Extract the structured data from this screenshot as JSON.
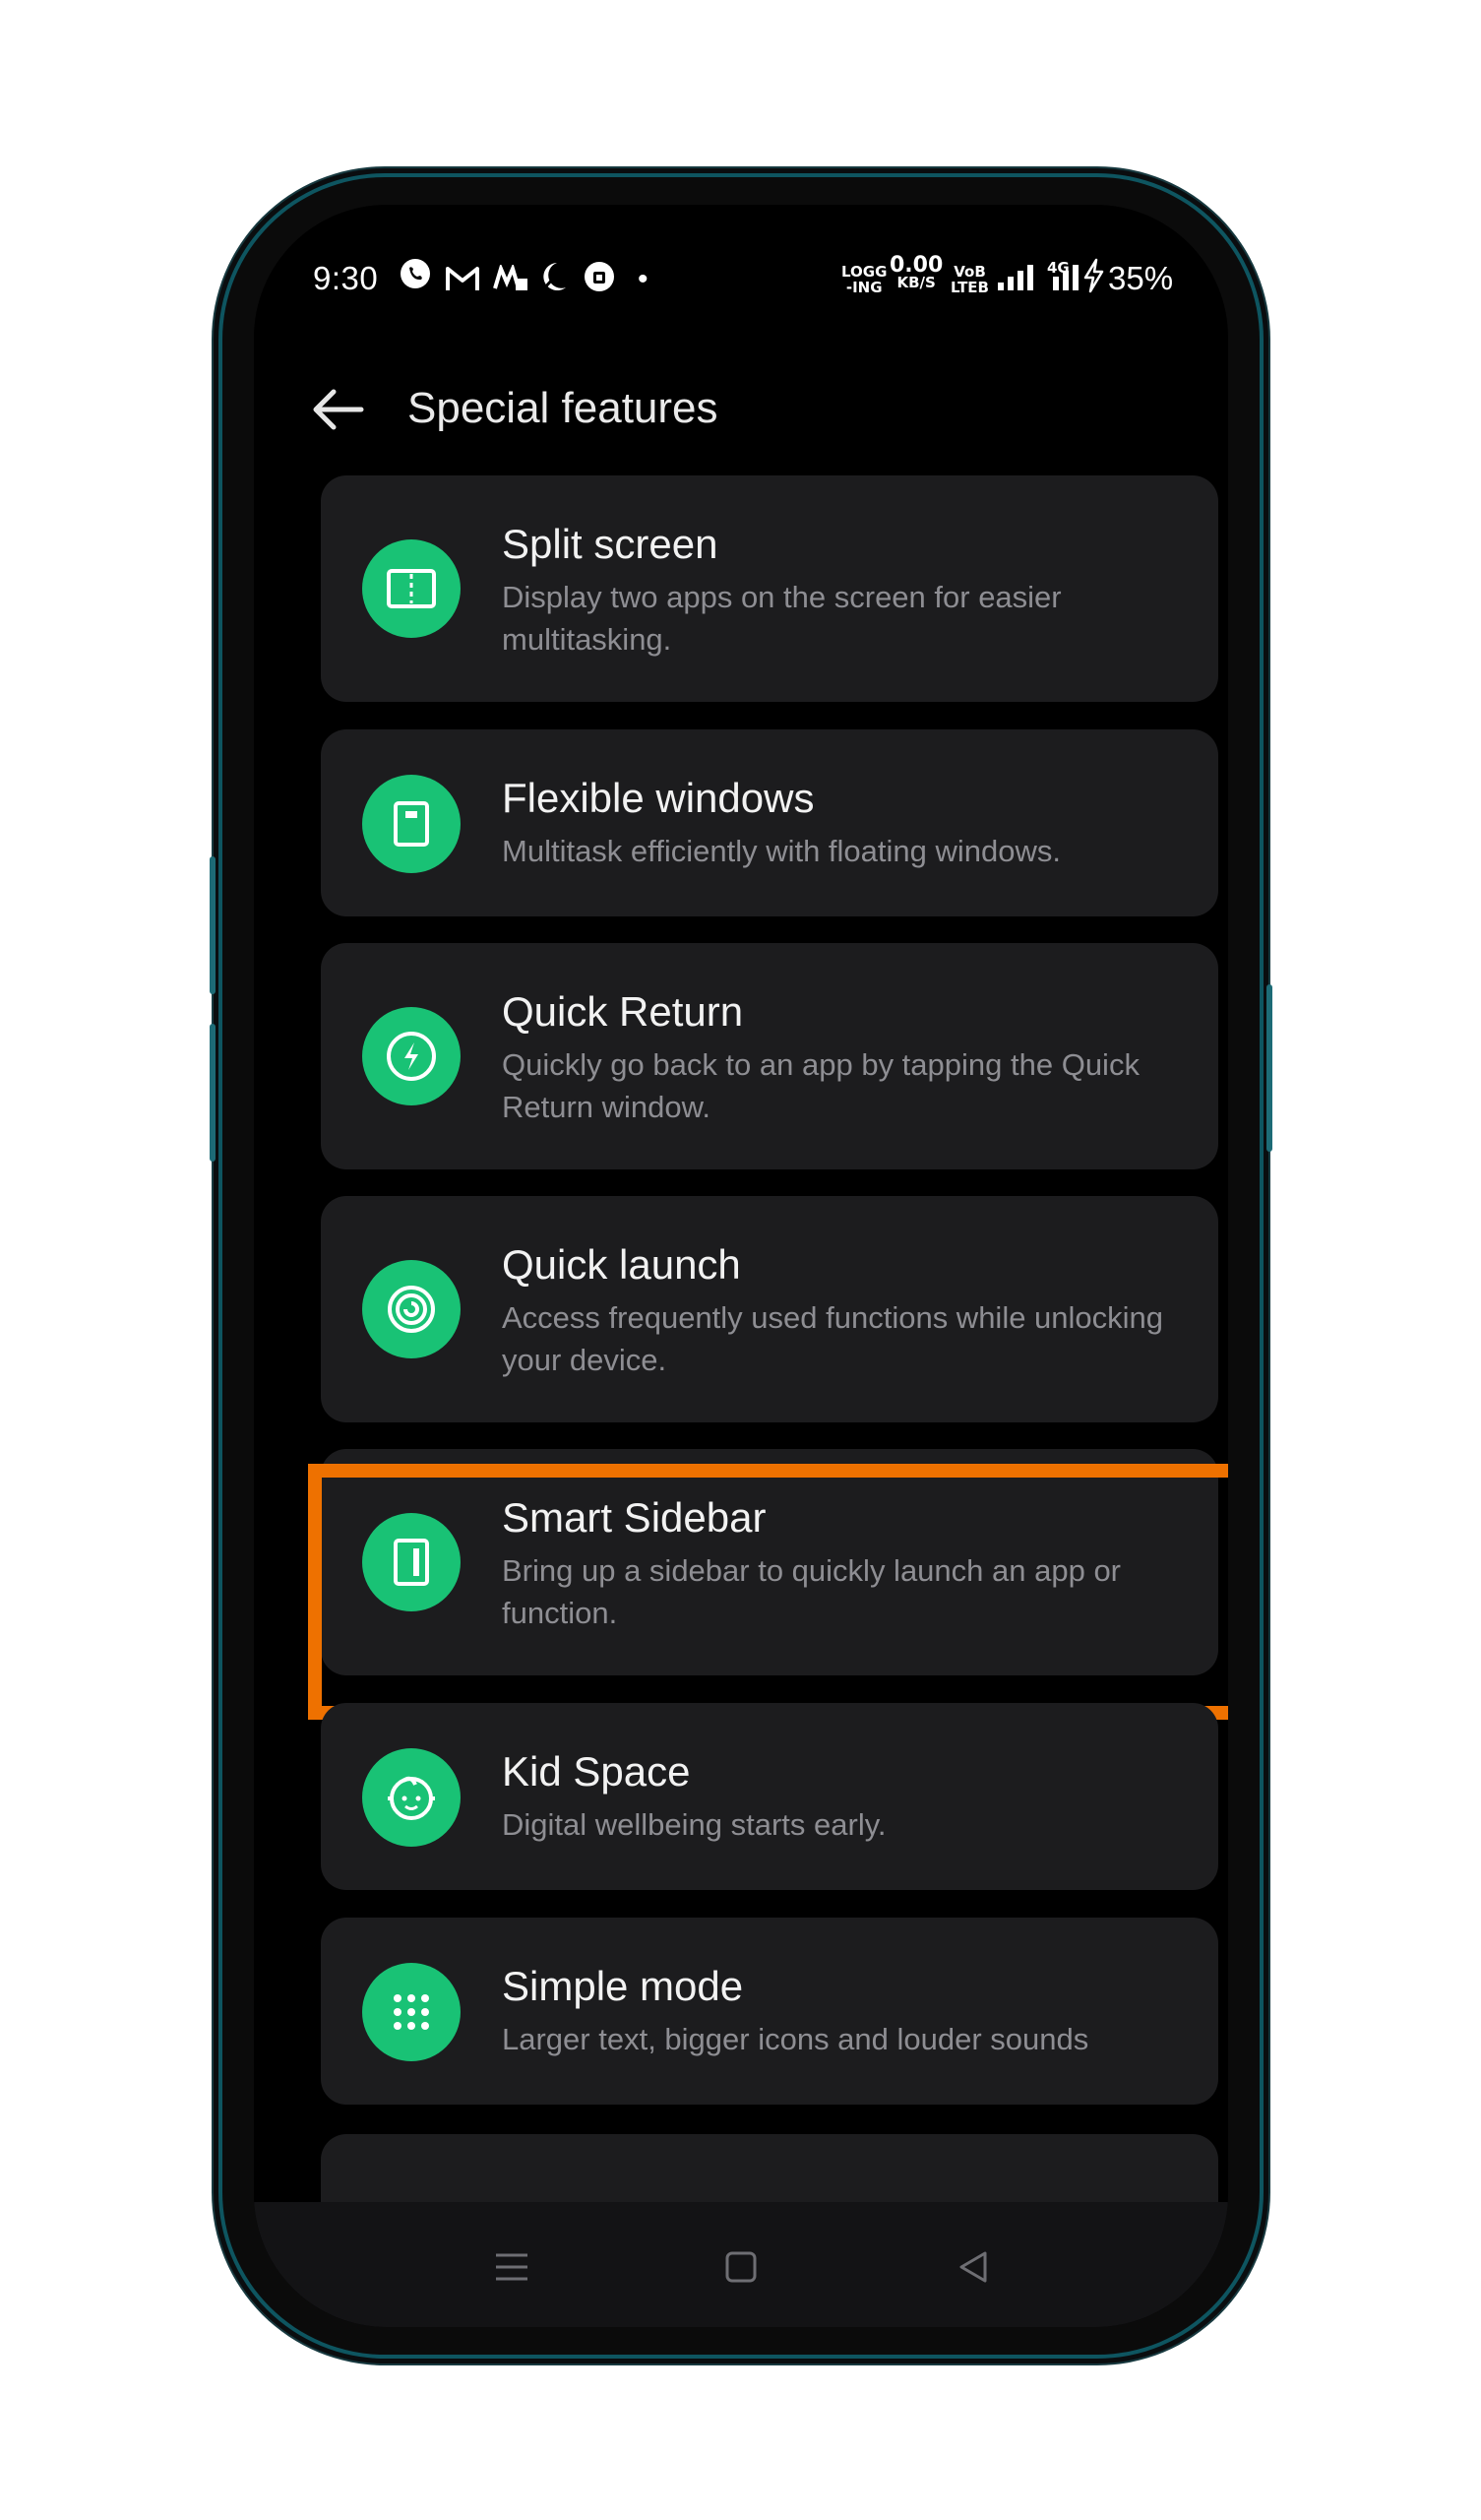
{
  "status_bar": {
    "time": "9:30",
    "net_label_top": "LOGG",
    "net_label_bottom": "-ING",
    "speed_value": "0.00",
    "speed_unit": "KB/S",
    "volte_top": "VoB",
    "volte_bottom": "LTEB",
    "network_type": "4G",
    "battery": "35%",
    "icons": [
      "whatsapp-icon",
      "gmail-icon",
      "app-icon",
      "moon-icon",
      "shield-icon",
      "dot-icon",
      "signal-icon",
      "charging-icon"
    ]
  },
  "header": {
    "title": "Special features",
    "back_icon": "arrow-left-icon"
  },
  "features": [
    {
      "title": "Split screen",
      "description": "Display two apps on the screen for easier multitasking.",
      "icon": "split-screen-icon"
    },
    {
      "title": "Flexible windows",
      "description": "Multitask efficiently with floating windows.",
      "icon": "flexible-window-icon"
    },
    {
      "title": "Quick Return",
      "description": "Quickly go back to an app by tapping the Quick Return window.",
      "icon": "lightning-icon"
    },
    {
      "title": "Quick launch",
      "description": "Access frequently used functions while unlocking your device.",
      "icon": "fingerprint-icon"
    },
    {
      "title": "Smart Sidebar",
      "description": "Bring up a sidebar to quickly launch an app or function.",
      "icon": "sidebar-icon"
    },
    {
      "title": "Kid Space",
      "description": "Digital wellbeing starts early.",
      "icon": "kid-face-icon"
    },
    {
      "title": "Simple mode",
      "description": "Larger text, bigger icons and louder sounds",
      "icon": "grid-dots-icon"
    }
  ],
  "highlighted_item": "Smart Sidebar",
  "colors": {
    "accent": "#19c275",
    "highlight": "#ee7100",
    "card": "#1c1c1e",
    "background": "#000000"
  },
  "navigation_bar": {
    "icons": [
      "menu-icon",
      "home-icon",
      "back-triangle-icon"
    ]
  }
}
